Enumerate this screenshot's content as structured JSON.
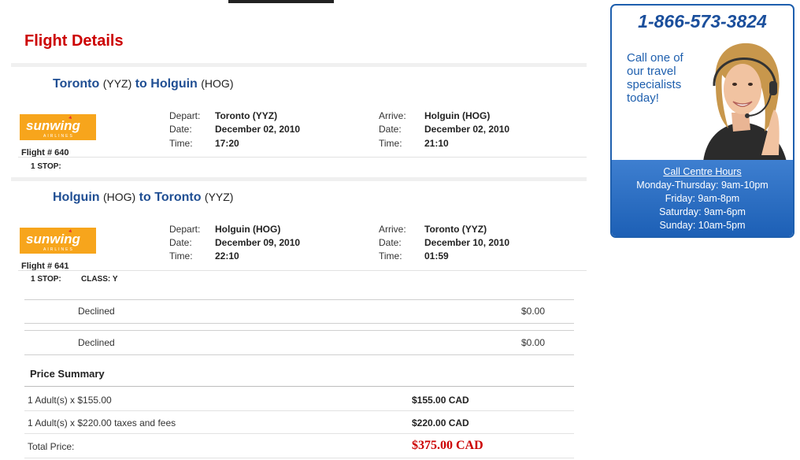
{
  "page": {
    "title": "Flight Details"
  },
  "flights": [
    {
      "route": {
        "from_city": "Toronto",
        "from_code": "(YYZ)",
        "connector": "to",
        "to_city": "Holguin",
        "to_code": "(HOG)"
      },
      "airline": {
        "logo_main": "sunwing",
        "logo_sub": "AIRLINES"
      },
      "flight_no": "Flight # 640",
      "stops": "1 STOP:",
      "class": "",
      "depart": {
        "label": "Depart:",
        "place": "Toronto (YYZ)",
        "date_label": "Date:",
        "date": "December 02, 2010",
        "time_label": "Time:",
        "time": "17:20"
      },
      "arrive": {
        "label": "Arrive:",
        "place": "Holguin (HOG)",
        "date_label": "Date:",
        "date": "December 02, 2010",
        "time_label": "Time:",
        "time": "21:10"
      }
    },
    {
      "route": {
        "from_city": "Holguin",
        "from_code": "(HOG)",
        "connector": "to",
        "to_city": "Toronto",
        "to_code": "(YYZ)"
      },
      "airline": {
        "logo_main": "sunwing",
        "logo_sub": "AIRLINES"
      },
      "flight_no": "Flight # 641",
      "stops": "1 STOP:",
      "class": "CLASS: Y",
      "depart": {
        "label": "Depart:",
        "place": "Holguin (HOG)",
        "date_label": "Date:",
        "date": "December 09, 2010",
        "time_label": "Time:",
        "time": "22:10"
      },
      "arrive": {
        "label": "Arrive:",
        "place": "Toronto (YYZ)",
        "date_label": "Date:",
        "date": "December 10, 2010",
        "time_label": "Time:",
        "time": "01:59"
      }
    }
  ],
  "options": [
    {
      "label": "Declined",
      "price": "$0.00"
    },
    {
      "label": "Declined",
      "price": "$0.00"
    }
  ],
  "price_summary": {
    "title": "Price Summary",
    "rows": [
      {
        "label": "1 Adult(s) x $155.00",
        "value": "$155.00 CAD"
      },
      {
        "label": "1 Adult(s) x $220.00 taxes and fees",
        "value": "$220.00 CAD"
      }
    ],
    "total_label": "Total Price:",
    "total_value": "$375.00 CAD"
  },
  "promo": {
    "phone": "1-866-573-3824",
    "call_text": "Call one of our travel specialists today!",
    "hours_title": "Call Centre Hours",
    "hours": [
      "Monday-Thursday: 9am-10pm",
      "Friday: 9am-8pm",
      "Saturday: 9am-6pm",
      "Sunday: 10am-5pm"
    ]
  },
  "colors": {
    "accent_red": "#cc0000",
    "route_blue": "#1f4e93",
    "promo_blue": "#1e5fae",
    "logo_orange": "#f7a51c"
  }
}
